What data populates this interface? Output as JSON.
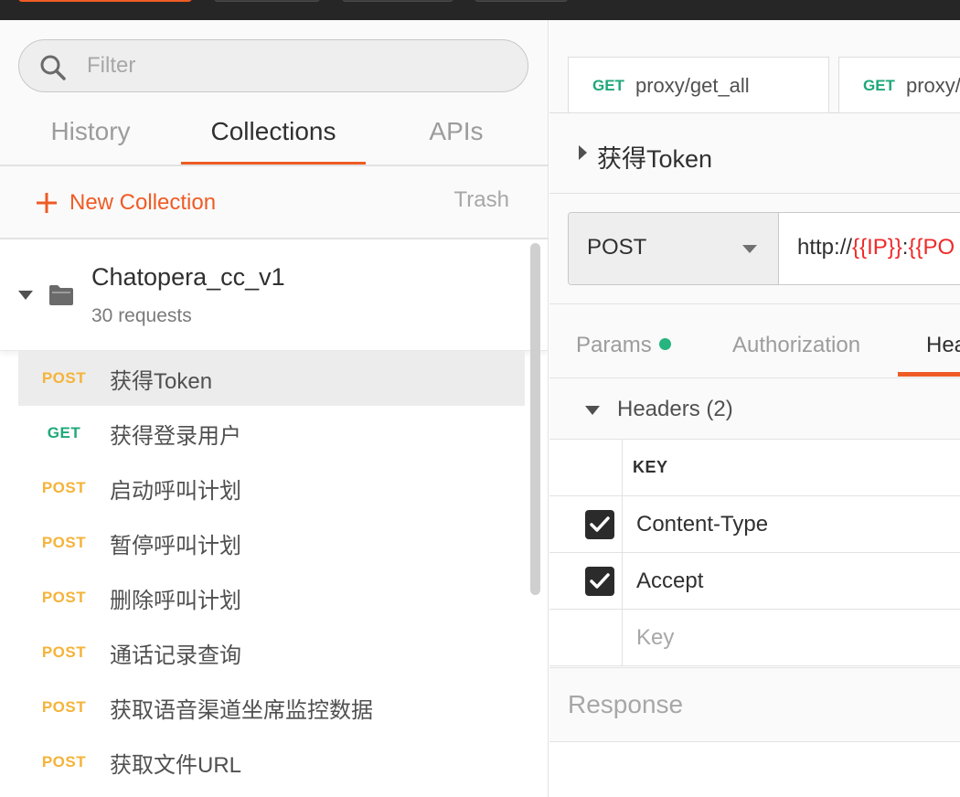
{
  "sidebar": {
    "filter_placeholder": "Filter",
    "tabs": [
      {
        "label": "History",
        "active": false
      },
      {
        "label": "Collections",
        "active": true
      },
      {
        "label": "APIs",
        "active": false
      }
    ],
    "new_collection_label": "New Collection",
    "trash_label": "Trash",
    "collection": {
      "name": "Chatopera_cc_v1",
      "count": "30 requests"
    },
    "requests": [
      {
        "method": "POST",
        "name": "获得Token",
        "selected": true
      },
      {
        "method": "GET",
        "name": "获得登录用户"
      },
      {
        "method": "POST",
        "name": "启动呼叫计划"
      },
      {
        "method": "POST",
        "name": "暂停呼叫计划"
      },
      {
        "method": "POST",
        "name": "删除呼叫计划"
      },
      {
        "method": "POST",
        "name": "通话记录查询"
      },
      {
        "method": "POST",
        "name": "获取语音渠道坐席监控数据"
      },
      {
        "method": "POST",
        "name": "获取文件URL"
      }
    ]
  },
  "main": {
    "open_tabs": [
      {
        "method": "GET",
        "url": "proxy/get_all"
      },
      {
        "method": "GET",
        "url": "proxy/"
      }
    ],
    "request_title": "获得Token",
    "method": "POST",
    "url": {
      "prefix": "http://",
      "var1": "{{IP}}",
      "sep": ":",
      "var2": "{{PO"
    },
    "subtabs": [
      {
        "label": "Params"
      },
      {
        "label": "Authorization"
      },
      {
        "label": "Hea"
      }
    ],
    "headers_title": "Headers",
    "headers_count": "(2)",
    "headers_table": {
      "key_header": "KEY",
      "rows": [
        {
          "key": "Content-Type",
          "checked": true
        },
        {
          "key": "Accept",
          "checked": true
        }
      ],
      "placeholder": "Key"
    },
    "response_label": "Response"
  },
  "colors": {
    "accent": "#ef5b25",
    "post": "#f5b339",
    "get": "#1fa87a",
    "variable": "#ef2a2a",
    "params_dot": "#26b47f"
  }
}
